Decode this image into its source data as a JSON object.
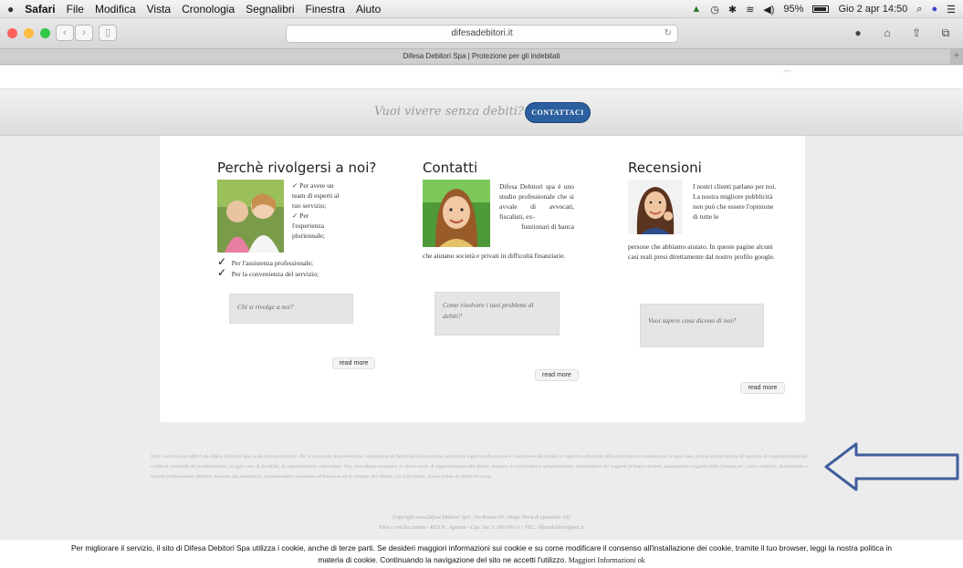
{
  "menubar": {
    "items": [
      "Safari",
      "File",
      "Modifica",
      "Vista",
      "Cronologia",
      "Segnalibri",
      "Finestra",
      "Aiuto"
    ],
    "battery": "95%",
    "clock": "Gio 2 apr  14:50"
  },
  "browser": {
    "url": "difesadebitori.it",
    "tab_title": "Difesa Debitori Spa | Protezione per gli indebitati"
  },
  "cta": {
    "question": "Vuoi vivere senza debiti?",
    "button": "CONTATTACI"
  },
  "columns": [
    {
      "title": "Perchè rivolgersi a noi?",
      "lines": [
        "✓  Per avere un",
        "team di esperti al",
        "tuo servizio;",
        "✓  Per",
        "l'esperienza",
        "pluriennale;"
      ],
      "bullets": [
        "Per l'assistenza professionale;",
        "Per la convenienza del servizio;"
      ],
      "quote": "Chi si rivolge a noi?",
      "read_more": "read more"
    },
    {
      "title": "Contatti",
      "side_text": "Difesa Debitori spa è uno studio professionale che si avvale di avvocati, fiscalisti, ex-",
      "side_last": "funzionari di banca",
      "full_text": "che aiutano società e privati in difficoltà finanziarie.",
      "quote": "Come risolvere i tuoi problemi di debiti?",
      "read_more": "read more"
    },
    {
      "title": "Recensioni",
      "side_text": "I nostri clienti parlano per noi. La nostra migliore pubblicità non può che essere l'opinione di tutte le",
      "full_text": "persone che abbiamo aiutato. In queste pagine alcuni casi reali presi direttamente dal nostro profilo google.",
      "quote": "Vuoi sapere cosa dicono di noi?",
      "read_more": "read more"
    }
  ],
  "footer": {
    "disclaimer": "Tutti i servizi sono offerti da Difesa Debitori Spa, a decorrenze previste. Per il contenuto in prevenzione, valutazione di fattibilità della pratica, assistenza legale professionale e risoluzione del debito in rapporto alla fonte della procedura o contenzioso, in ogni caso, previa sottoscrizione di incarico di rappresentanza dei creditori eventuali del professionista, in ogni caso di fiscalisti, di rappresentanti concordato. Non intendiamo assumere in alcun modo di rappresentanza del debito, nessuno in particolare e semplicemente, intermediari dei soggetti privati e società, assumeremo soggetti della finanza per i loro creditori, direttamente e tramite professionisti abilitati, nessuno più aspettativa, promuoviamo comunque all'interesse ed in sviluppi del cliente, con il fornitore, presso fondo di valore di cassa.",
    "copyright_1": "Copyright www.Difesa Debitori SpA | Via Rovere 90 | Borgo Terra di Quartiere 102",
    "copyright_2": "P.iva e cod.fisc.azione - REA N.: Agenzia - Cap. Soc. € 100.000 i.v. | PEC: difesadebitori@pec.it"
  },
  "cookie": {
    "text_1": "Per migliorare il servizio, il sito di Difesa Debitori Spa utilizza i cookie, anche di terze parti. Se desideri maggiori informazioni sui cookie e su come modificare il consenso all'installazione dei cookie, tramite il tuo browser, leggi la nostra politica in",
    "text_2": "materia di cookie. Continuando la navigazione del sito ne accetti l'utilizzo.",
    "more_info": "Maggiori Informazioni",
    "ok": "ok"
  }
}
